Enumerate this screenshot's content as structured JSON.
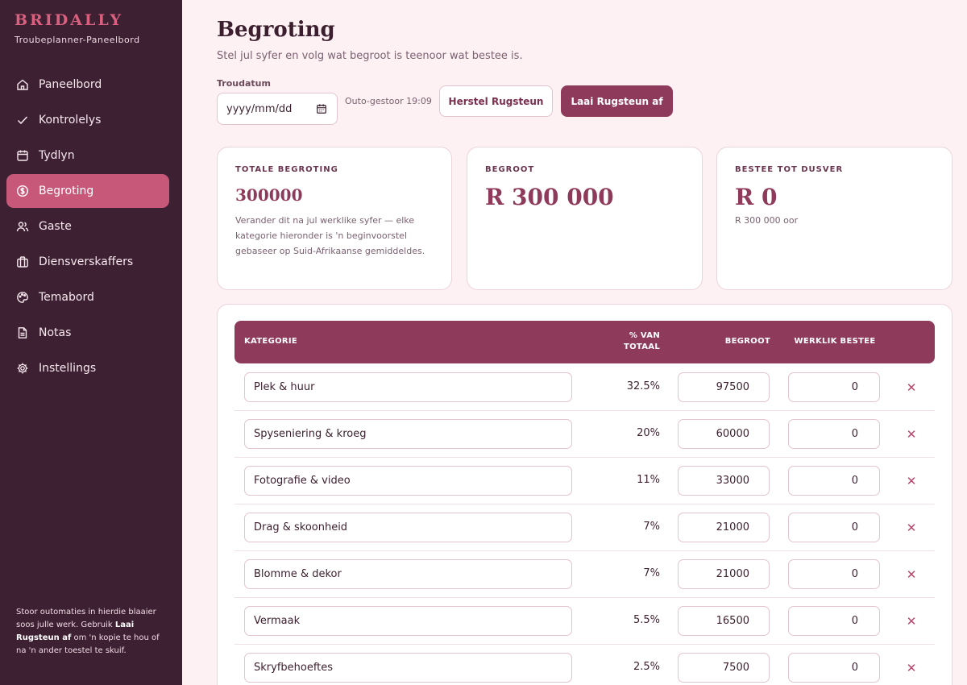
{
  "sidebar": {
    "brand": "BRIDALLY",
    "subtitle": "Troubeplanner-Paneelbord",
    "items": [
      {
        "label": "Paneelbord",
        "icon": "home-icon"
      },
      {
        "label": "Kontrolelys",
        "icon": "check-icon"
      },
      {
        "label": "Tydlyn",
        "icon": "calendar-icon"
      },
      {
        "label": "Begroting",
        "icon": "dollar-circle-icon",
        "active": true
      },
      {
        "label": "Gaste",
        "icon": "users-icon"
      },
      {
        "label": "Diensverskaffers",
        "icon": "briefcase-icon"
      },
      {
        "label": "Temabord",
        "icon": "palette-icon"
      },
      {
        "label": "Notas",
        "icon": "document-icon"
      },
      {
        "label": "Instellings",
        "icon": "gear-icon"
      }
    ],
    "note_before": "Stoor outomaties in hierdie blaaier soos julle werk. Gebruik ",
    "note_bold": "Laai Rugsteun af",
    "note_after": " om 'n kopie te hou of na 'n ander toestel te skuif."
  },
  "header": {
    "title": "Begroting",
    "subtitle": "Stel jul syfer en volg wat begroot is teenoor wat bestee is.",
    "date_label": "Troudatum",
    "date_placeholder": "yyyy/mm/dd",
    "autosave": "Outo-gestoor 19:09",
    "restore_label": "Herstel Rugsteun",
    "download_label": "Laai Rugsteun af"
  },
  "cards": {
    "total": {
      "label": "TOTALE BEGROTING",
      "value": "300000",
      "desc": "Verander dit na jul werklike syfer — elke kategorie hieronder is 'n beginvoorstel gebaseer op Suid-Afrikaanse gemiddeldes."
    },
    "budgeted": {
      "label": "BEGROOT",
      "value": "R 300 000"
    },
    "spent": {
      "label": "BESTEE TOT DUSVER",
      "value": "R 0",
      "remaining": "R 300 000 oor"
    }
  },
  "table": {
    "headers": {
      "category": "KATEGORIE",
      "pct_line1": "% VAN",
      "pct_line2": "TOTAAL",
      "budget": "BEGROOT",
      "actual": "WERKLIK BESTEE"
    },
    "delete_glyph": "✕",
    "rows": [
      {
        "name": "Plek & huur",
        "pct": "32.5%",
        "budget": "97500",
        "actual": "0"
      },
      {
        "name": "Spyseniering & kroeg",
        "pct": "20%",
        "budget": "60000",
        "actual": "0"
      },
      {
        "name": "Fotografie & video",
        "pct": "11%",
        "budget": "33000",
        "actual": "0"
      },
      {
        "name": "Drag & skoonheid",
        "pct": "7%",
        "budget": "21000",
        "actual": "0"
      },
      {
        "name": "Blomme & dekor",
        "pct": "7%",
        "budget": "21000",
        "actual": "0"
      },
      {
        "name": "Vermaak",
        "pct": "5.5%",
        "budget": "16500",
        "actual": "0"
      },
      {
        "name": "Skryfbehoeftes",
        "pct": "2.5%",
        "budget": "7500",
        "actual": "0"
      }
    ]
  },
  "colors": {
    "sidebar": "#3d2032",
    "accent": "#c8587a",
    "primary": "#8e3a5a",
    "background": "#fdf1f3"
  }
}
